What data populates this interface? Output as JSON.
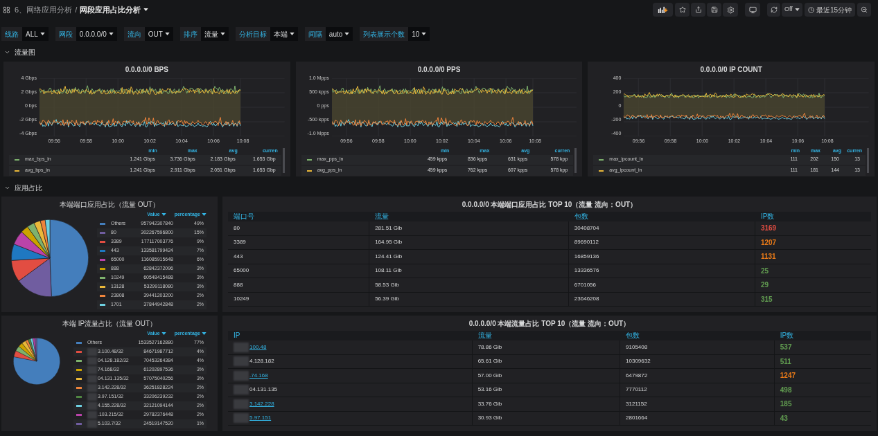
{
  "breadcrumb": {
    "folder": "6、网络应用分析",
    "separator": "/",
    "title": "网段应用占比分析"
  },
  "toolbar": {
    "refresh": "Off",
    "time_range": "最近15分钟"
  },
  "variables": [
    {
      "label": "线路",
      "value": "ALL"
    },
    {
      "label": "网段",
      "value": "0.0.0.0/0"
    },
    {
      "label": "流向",
      "value": "OUT"
    },
    {
      "label": "排序",
      "value": "流量"
    },
    {
      "label": "分析目标",
      "value": "本端"
    },
    {
      "label": "间隔",
      "value": "auto"
    },
    {
      "label": "列表展示个数",
      "value": "10"
    }
  ],
  "traffic_row": {
    "title": "流量图",
    "expanded": true,
    "graphs": [
      {
        "title": "0.0.0.0/0 BPS",
        "y_labels": [
          "4 Gbps",
          "2 Gbps",
          "0 bps",
          "-2 Gbps",
          "-4 Gbps"
        ],
        "x_labels": [
          "09:56",
          "09:58",
          "10:00",
          "10:02",
          "10:04",
          "10:06",
          "10:08"
        ],
        "legend_columns": [
          "min",
          "max",
          "avg",
          "curren"
        ],
        "series": [
          {
            "name": "max_bps_in",
            "color": "#7eb26d",
            "values": [
              "1.241 Gbps",
              "3.736 Gbps",
              "2.183 Gbps",
              "1.653 Gbp"
            ]
          },
          {
            "name": "avg_bps_in",
            "color": "#eab839",
            "values": [
              "1.241 Gbps",
              "2.911 Gbps",
              "2.051 Gbps",
              "1.653 Gbp"
            ]
          }
        ]
      },
      {
        "title": "0.0.0.0/0 PPS",
        "y_labels": [
          "1.0 Mpps",
          "500 kpps",
          "0 pps",
          "-500 kpps",
          "-1.0 Mpps"
        ],
        "x_labels": [
          "09:56",
          "09:58",
          "10:00",
          "10:02",
          "10:04",
          "10:06",
          "10:08"
        ],
        "legend_columns": [
          "min",
          "max",
          "avg",
          "curren"
        ],
        "series": [
          {
            "name": "max_pps_in",
            "color": "#7eb26d",
            "values": [
              "459 kpps",
              "836 kpps",
              "631 kpps",
              "578 kpp"
            ]
          },
          {
            "name": "avg_pps_in",
            "color": "#eab839",
            "values": [
              "459 kpps",
              "762 kpps",
              "607 kpps",
              "578 kpp"
            ]
          }
        ]
      },
      {
        "title": "0.0.0.0/0 IP COUNT",
        "y_labels": [
          "400",
          "200",
          "0",
          "-200",
          "-400"
        ],
        "x_labels": [
          "09:56",
          "09:58",
          "10:00",
          "10:02",
          "10:04",
          "10:06",
          "10:08"
        ],
        "legend_columns": [
          "min",
          "max",
          "avg",
          "curren"
        ],
        "series": [
          {
            "name": "max_ipcount_in",
            "color": "#7eb26d",
            "values": [
              "111",
              "202",
              "150",
              "13"
            ]
          },
          {
            "name": "avg_ipcount_in",
            "color": "#eab839",
            "values": [
              "111",
              "181",
              "144",
              "13"
            ]
          }
        ]
      }
    ]
  },
  "share_row": {
    "title": "应用占比",
    "expanded": true,
    "panels": [
      {
        "pie": {
          "title": "本端端口应用占比（流量 OUT）",
          "columns": [
            "Value",
            "percentage"
          ],
          "items": [
            {
              "label": "Others",
              "value": "957942307840",
              "percentage": "49%",
              "color": "#447ebc"
            },
            {
              "label": "80",
              "value": "302267596800",
              "percentage": "15%",
              "color": "#705da0"
            },
            {
              "label": "3389",
              "value": "177117003776",
              "percentage": "9%",
              "color": "#e24d42"
            },
            {
              "label": "443",
              "value": "133581799424",
              "percentage": "7%",
              "color": "#1f78c1"
            },
            {
              "label": "65000",
              "value": "116085915648",
              "percentage": "6%",
              "color": "#ba43a9"
            },
            {
              "label": "888",
              "value": "62842372096",
              "percentage": "3%",
              "color": "#cca300"
            },
            {
              "label": "10249",
              "value": "60548415488",
              "percentage": "3%",
              "color": "#7eb26d"
            },
            {
              "label": "13128",
              "value": "53299118080",
              "percentage": "3%",
              "color": "#eab839"
            },
            {
              "label": "23808",
              "value": "39441203200",
              "percentage": "2%",
              "color": "#ef843c"
            },
            {
              "label": "1701",
              "value": "37844942848",
              "percentage": "2%",
              "color": "#6ed0e0"
            }
          ]
        },
        "table": {
          "title": "0.0.0.0/0 本端端口应用占比 TOP 10（流量 流向：OUT）",
          "columns": [
            "端口号",
            "流量",
            "包数",
            "IP数"
          ],
          "rows": [
            {
              "cells": [
                "80",
                "281.51 Gib",
                "30408704",
                "3169"
              ],
              "color": "#e24d42"
            },
            {
              "cells": [
                "3389",
                "164.95 Gib",
                "89690112",
                "1207"
              ],
              "color": "#eb7b18"
            },
            {
              "cells": [
                "443",
                "124.41 Gib",
                "16859136",
                "1131"
              ],
              "color": "#eb7b18"
            },
            {
              "cells": [
                "65000",
                "108.11 Gib",
                "13336576",
                "25"
              ],
              "color": "#629e51"
            },
            {
              "cells": [
                "888",
                "58.53 Gib",
                "6701056",
                "29"
              ],
              "color": "#629e51"
            },
            {
              "cells": [
                "10249",
                "56.39 Gib",
                "23646208",
                "315"
              ],
              "color": "#629e51"
            }
          ]
        }
      },
      {
        "pie": {
          "title": "本端 IP流量占比（流量 OUT）",
          "columns": [
            "Value",
            "percentage"
          ],
          "items": [
            {
              "label": "Others",
              "value": "1533527162880",
              "percentage": "77%",
              "color": "#447ebc"
            },
            {
              "label": "3.100.48/32",
              "value": "84671987712",
              "percentage": "4%",
              "color": "#e24d42"
            },
            {
              "label": "04.128.182/32",
              "value": "70453264384",
              "percentage": "4%",
              "color": "#7eb26d"
            },
            {
              "label": "74.168/32",
              "value": "61202897536",
              "percentage": "3%",
              "color": "#cca300"
            },
            {
              "label": "04.131.135/32",
              "value": "57075040256",
              "percentage": "3%",
              "color": "#eab839"
            },
            {
              "label": "3.142.228/32",
              "value": "36251828224",
              "percentage": "2%",
              "color": "#ef843c"
            },
            {
              "label": "3.97.151/32",
              "value": "33206239232",
              "percentage": "2%",
              "color": "#508642"
            },
            {
              "label": "4.155.228/32",
              "value": "32121094144",
              "percentage": "2%",
              "color": "#6ed0e0"
            },
            {
              "label": ".103.215/32",
              "value": "29782376448",
              "percentage": "2%",
              "color": "#ba43a9"
            },
            {
              "label": "5.103.7/32",
              "value": "24519147520",
              "percentage": "1%",
              "color": "#705da0"
            }
          ]
        },
        "table": {
          "title": "0.0.0.0/0 本端流量占比 TOP 10（流量 流向：OUT）",
          "columns": [
            "IP",
            "流量",
            "包数",
            "IP数"
          ],
          "rows": [
            {
              "cells": [
                "100.48",
                "78.86 Gib",
                "9105408",
                "537"
              ],
              "color": "#629e51",
              "link": true
            },
            {
              "cells": [
                "4.128.182",
                "65.61 Gib",
                "10309632",
                "511"
              ],
              "color": "#629e51",
              "link": false
            },
            {
              "cells": [
                ".74.168",
                "57.00 Gib",
                "6479872",
                "1247"
              ],
              "color": "#eb7b18",
              "link": true
            },
            {
              "cells": [
                "04.131.135",
                "53.16 Gib",
                "7770112",
                "498"
              ],
              "color": "#629e51",
              "link": false
            },
            {
              "cells": [
                "3.142.228",
                "33.76 Gib",
                "3121152",
                "185"
              ],
              "color": "#629e51",
              "link": true
            },
            {
              "cells": [
                "5.97.151",
                "30.93 Gib",
                "2801664",
                "43"
              ],
              "color": "#629e51",
              "link": true
            }
          ]
        }
      }
    ]
  }
}
